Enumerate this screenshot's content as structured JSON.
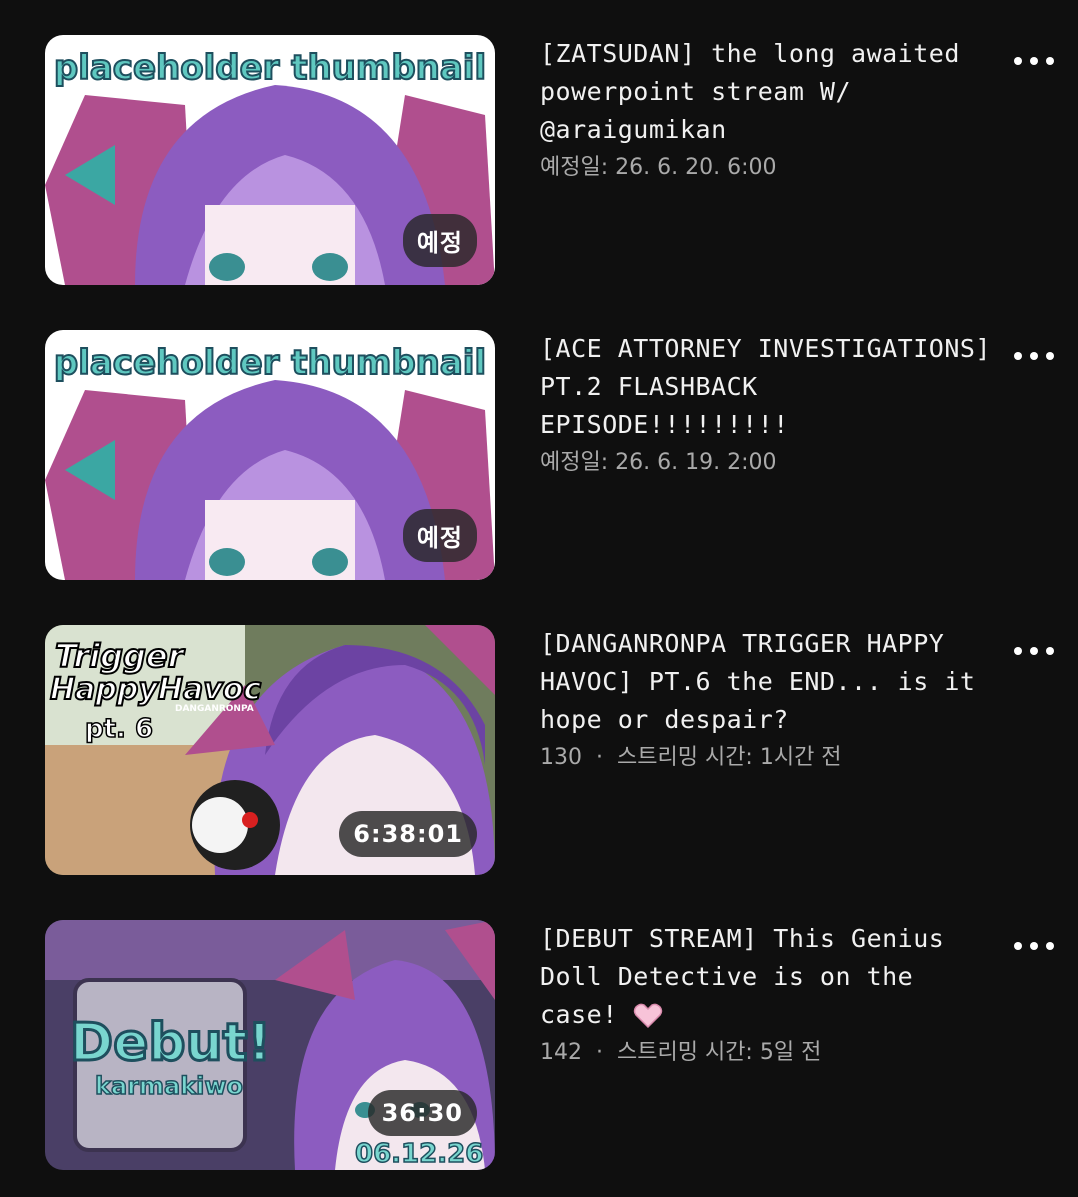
{
  "videos": [
    {
      "title": "[ZATSUDAN] the long awaited powerpoint stream W/ @araigumikan",
      "meta": "예정일: 26. 6. 20. 6:00",
      "badge": "예정",
      "thumb_text": "placeholder thumbnail",
      "menu_icon": "more-vert-icon"
    },
    {
      "title": "[ACE ATTORNEY INVESTIGATIONS] PT.2 FLASHBACK EPISODE!!!!!!!!!",
      "meta": "예정일: 26. 6. 19. 2:00",
      "badge": "예정",
      "thumb_text": "placeholder thumbnail",
      "menu_icon": "more-vert-icon"
    },
    {
      "title": "[DANGANRONPA TRIGGER HAPPY HAVOC] PT.6  the END... is it hope or despair?",
      "views": "130",
      "separator": "·",
      "streamed": "스트리밍 시간: 1시간 전",
      "badge": "6:38:01",
      "thumb_text_1": "Trigger",
      "thumb_text_2": "HappyHavoc",
      "thumb_text_3": "DANGANRONPA",
      "thumb_text_4": "pt. 6",
      "menu_icon": "more-vert-icon"
    },
    {
      "title": "[DEBUT STREAM] This Genius Doll Detective is on the case!",
      "title_icon": "pink-heart-icon",
      "views": "142",
      "separator": "·",
      "streamed": "스트리밍 시간: 5일 전",
      "badge": "36:30",
      "thumb_text_1": "Debut!",
      "thumb_text_2": "karmakiwo",
      "thumb_text_3": "06.12.26",
      "menu_icon": "more-vert-icon"
    }
  ],
  "colors": {
    "background": "#0f0f0f",
    "text": "#f1f1f1",
    "meta": "#aaaaaa",
    "hair": "#8c5cc0",
    "ears": "#b04f8e",
    "thumb_teal": "#2f9aa0"
  }
}
